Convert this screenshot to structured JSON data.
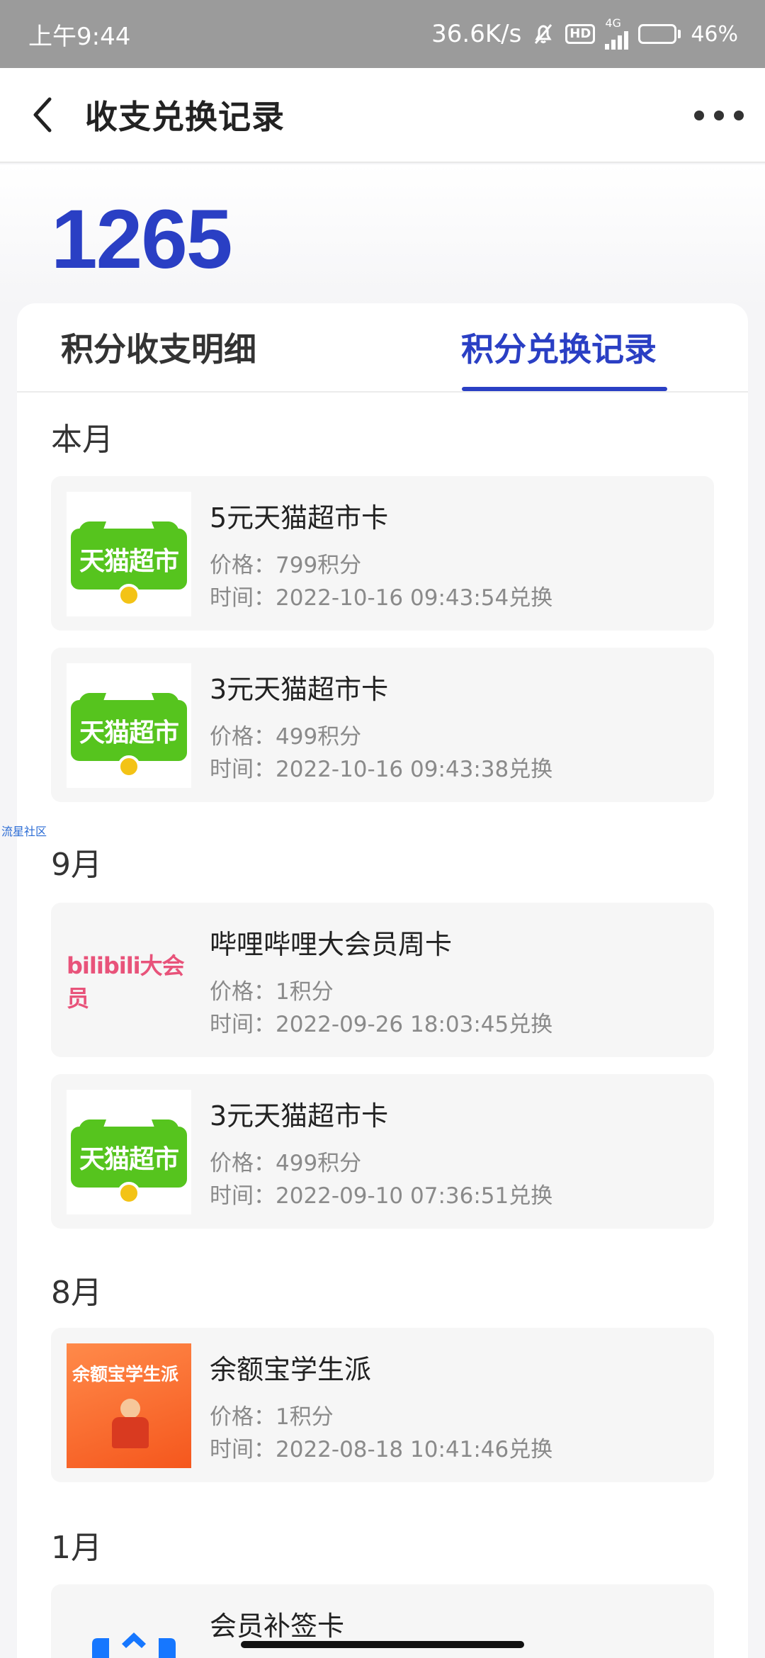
{
  "status_bar": {
    "time": "上午9:44",
    "network_speed": "36.6K/s",
    "hd_label": "HD",
    "network_type": "4G",
    "battery": "46%",
    "battery_level": 0.46
  },
  "header": {
    "title": "收支兑换记录"
  },
  "points": {
    "value": "1265"
  },
  "tabs": [
    {
      "label": "积分收支明细",
      "active": false
    },
    {
      "label": "积分兑换记录",
      "active": true
    }
  ],
  "months": [
    {
      "label": "本月"
    },
    {
      "label": "9月"
    },
    {
      "label": "8月"
    },
    {
      "label": "1月"
    }
  ],
  "records": [
    {
      "logo": "天猫超市",
      "title": "5元天猫超市卡",
      "price": "价格：799积分",
      "time": "时间：2022-10-16 09:43:54兑换"
    },
    {
      "logo": "天猫超市",
      "title": "3元天猫超市卡",
      "price": "价格：499积分",
      "time": "时间：2022-10-16 09:43:38兑换"
    },
    {
      "logo": "bilibili大会员",
      "title": "哔哩哔哩大会员周卡",
      "price": "价格：1积分",
      "time": "时间：2022-09-26 18:03:45兑换"
    },
    {
      "logo": "天猫超市",
      "title": "3元天猫超市卡",
      "price": "价格：499积分",
      "time": "时间：2022-09-10 07:36:51兑换"
    },
    {
      "logo": "余额宝学生派",
      "title": "余额宝学生派",
      "price": "价格：1积分",
      "time": "时间：2022-08-18 10:41:46兑换"
    },
    {
      "logo": "",
      "title": "会员补签卡",
      "price": "",
      "time": ""
    }
  ],
  "watermark": "流星社区",
  "colors": {
    "accent": "#2a3fc4",
    "tmall_green": "#56c41e",
    "bili_pink": "#e8537a",
    "yeb_orange": "#f5571d"
  }
}
